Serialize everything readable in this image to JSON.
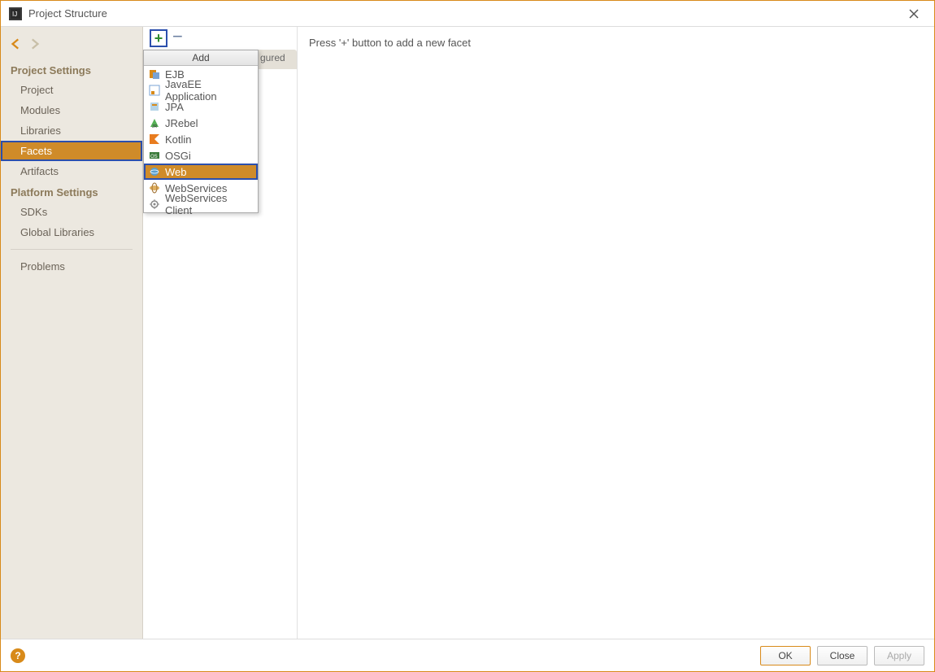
{
  "window": {
    "title": "Project Structure"
  },
  "sidebar": {
    "section1_label": "Project Settings",
    "section2_label": "Platform Settings",
    "items1": [
      {
        "label": "Project"
      },
      {
        "label": "Modules"
      },
      {
        "label": "Libraries"
      },
      {
        "label": "Facets"
      },
      {
        "label": "Artifacts"
      }
    ],
    "items2": [
      {
        "label": "SDKs"
      },
      {
        "label": "Global Libraries"
      }
    ],
    "problems_label": "Problems"
  },
  "midcol": {
    "tab_partial": "gured"
  },
  "popup": {
    "header": "Add",
    "items": [
      {
        "label": "EJB",
        "icon": "ejb-icon"
      },
      {
        "label": "JavaEE Application",
        "icon": "javaee-icon"
      },
      {
        "label": "JPA",
        "icon": "jpa-icon"
      },
      {
        "label": "JRebel",
        "icon": "jrebel-icon"
      },
      {
        "label": "Kotlin",
        "icon": "kotlin-icon"
      },
      {
        "label": "OSGi",
        "icon": "osgi-icon"
      },
      {
        "label": "Web",
        "icon": "web-icon"
      },
      {
        "label": "WebServices",
        "icon": "webservices-icon"
      },
      {
        "label": "WebServices Client",
        "icon": "webservices-client-icon"
      }
    ],
    "selected_index": 6
  },
  "content": {
    "hint": "Press '+' button to add a new facet"
  },
  "footer": {
    "ok": "OK",
    "close": "Close",
    "apply": "Apply"
  }
}
